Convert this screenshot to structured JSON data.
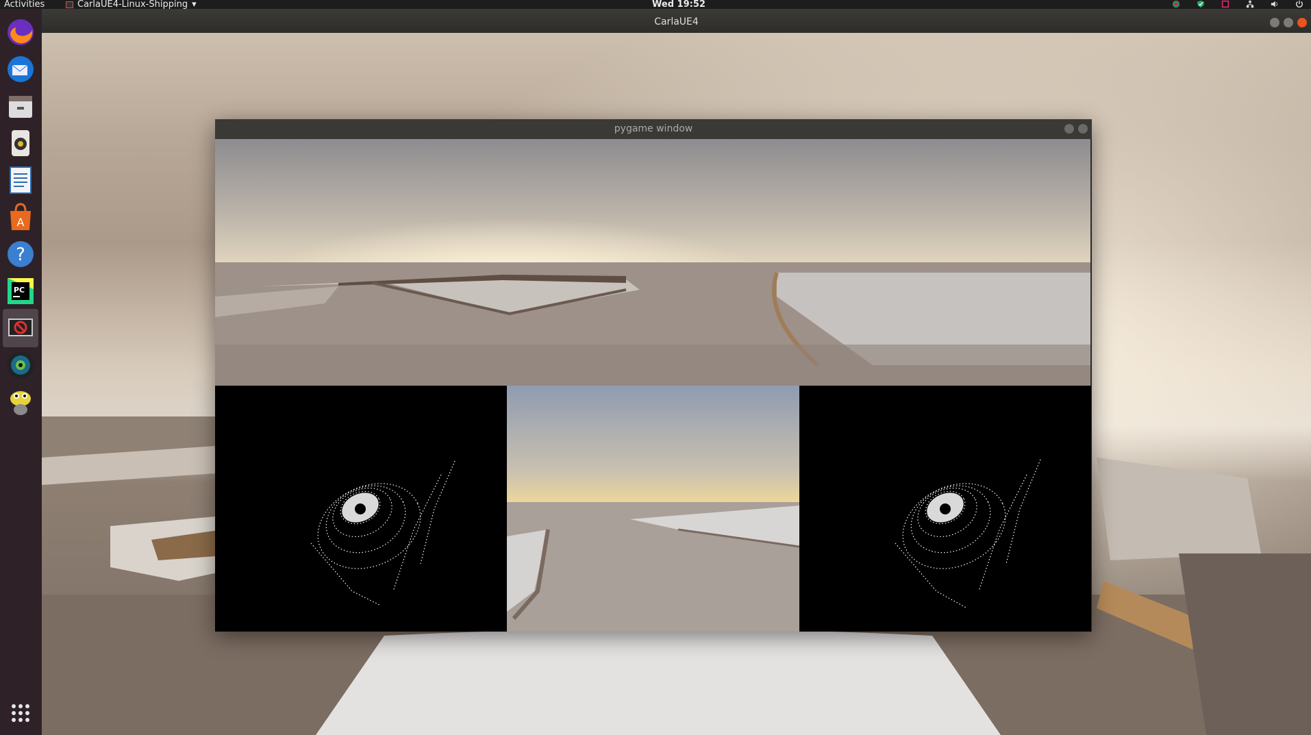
{
  "topbar": {
    "activities_label": "Activities",
    "app_menu_label": "CarlaUE4-Linux-Shipping",
    "clock": "Wed 19:52",
    "tray_icons": [
      "color-picker-icon",
      "check-shield-icon",
      "jetbrains-toolbox-icon",
      "network-icon",
      "volume-icon",
      "power-icon"
    ]
  },
  "window": {
    "title": "CarlaUE4"
  },
  "dock": {
    "items": [
      {
        "name": "firefox-icon"
      },
      {
        "name": "thunderbird-icon"
      },
      {
        "name": "files-icon"
      },
      {
        "name": "rhythmbox-icon"
      },
      {
        "name": "libreoffice-writer-icon"
      },
      {
        "name": "ubuntu-software-icon"
      },
      {
        "name": "help-icon"
      },
      {
        "name": "pycharm-icon",
        "badge": "PC"
      },
      {
        "name": "carla-app-icon"
      },
      {
        "name": "camera-app-icon"
      },
      {
        "name": "gecko-mascot-icon"
      },
      {
        "name": "show-applications-icon"
      }
    ]
  },
  "pygame": {
    "title": "pygame window",
    "panels": [
      "rgb-panorama-camera",
      "lidar-left",
      "front-rgb-camera",
      "lidar-right"
    ]
  },
  "colors": {
    "topbar": "#1d1d1d",
    "dock": "#281c24",
    "window_close": "#e9541f",
    "lidar_bg": "#000000",
    "lidar_points": "#ffffff"
  }
}
